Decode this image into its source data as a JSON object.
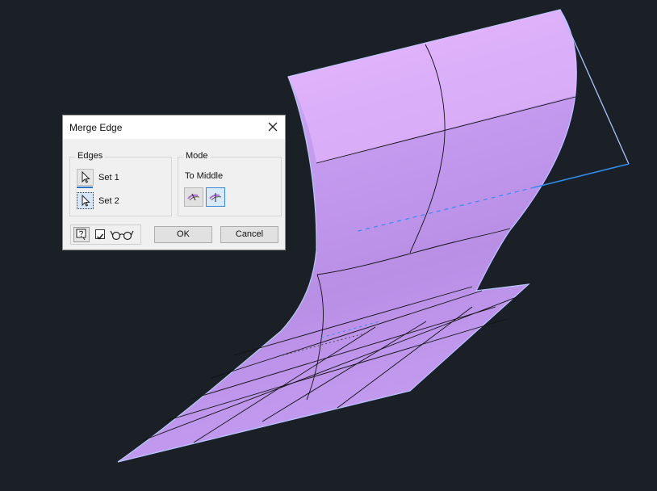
{
  "dialog": {
    "title": "Merge Edge",
    "close_icon": "close-icon",
    "edges": {
      "label": "Edges",
      "set1_label": "Set 1",
      "set2_label": "Set 2",
      "select_icon": "cursor-arrow-icon"
    },
    "mode": {
      "label": "Mode",
      "value": "To Middle",
      "options": [
        "merge-left-icon",
        "merge-middle-icon"
      ],
      "selected_option": "merge-middle-icon"
    },
    "footer": {
      "help_icon": "help-icon",
      "preview_checked": true,
      "preview_icon": "glasses-icon",
      "ok_label": "OK",
      "cancel_label": "Cancel"
    }
  },
  "viewport": {
    "background": "#1b1f26",
    "surface_color": "#c6a3f2",
    "surface_edge_color": "#a9c4ff",
    "highlight_edge_color": "#2f8ef0"
  }
}
